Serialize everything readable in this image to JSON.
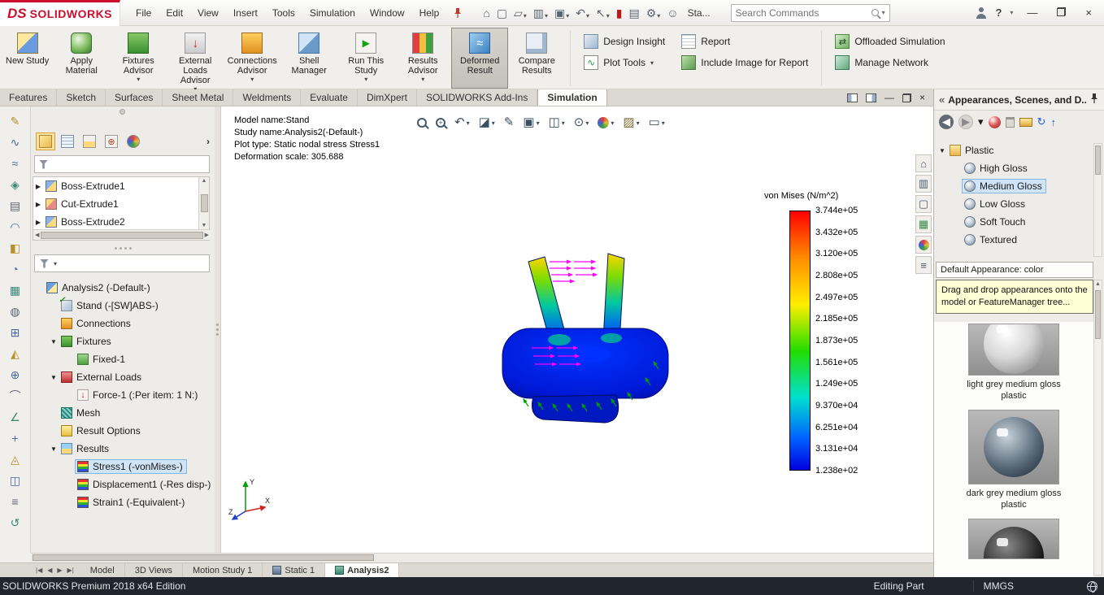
{
  "icons": {
    "chevron_right": "›",
    "caret_down": "▾",
    "caret_up": "▲",
    "caret_down_solid": "▼",
    "scroll_left": "◀",
    "scroll_right": "▶",
    "minimize": "—",
    "close": "×",
    "help": "?"
  },
  "titlebar": {
    "logo_ds": "DS",
    "logo_text": "SOLIDWORKS",
    "menus": [
      "File",
      "Edit",
      "View",
      "Insert",
      "Tools",
      "Simulation",
      "Window",
      "Help"
    ],
    "quick_tools": [
      {
        "icon": "home-icon",
        "glyph": "⌂"
      },
      {
        "icon": "new-document-icon",
        "glyph": "▢"
      },
      {
        "icon": "open-document-icon",
        "glyph": "▱",
        "caret": "▾"
      },
      {
        "icon": "save-icon",
        "glyph": "▥",
        "caret": "▾"
      },
      {
        "icon": "print-icon",
        "glyph": "▣",
        "caret": "▾"
      },
      {
        "icon": "undo-icon",
        "glyph": "↶",
        "caret": "▾"
      },
      {
        "icon": "select-icon",
        "glyph": "↖",
        "caret": "▾"
      },
      {
        "icon": "rebuild-icon",
        "glyph": "▮",
        "color": "#c01818"
      },
      {
        "icon": "file-properties-icon",
        "glyph": "▤"
      },
      {
        "icon": "options-icon",
        "glyph": "⚙",
        "caret": "▾"
      },
      {
        "icon": "add-user-icon",
        "glyph": "☺"
      },
      {
        "icon": "",
        "glyph": "",
        "label": "Sta..."
      }
    ],
    "search_placeholder": "Search Commands"
  },
  "ribbon": {
    "big_buttons": [
      {
        "label": "New Study",
        "icon": "new-study-icon"
      },
      {
        "label": "Apply Material",
        "icon": "apply-material-icon"
      },
      {
        "label": "Fixtures Advisor",
        "icon": "fixtures-advisor-icon",
        "caret": "▾"
      },
      {
        "label": "External Loads Advisor",
        "icon": "external-loads-advisor-icon",
        "caret": "▾"
      },
      {
        "label": "Connections Advisor",
        "icon": "connections-advisor-icon",
        "caret": "▾"
      },
      {
        "label": "Shell Manager",
        "icon": "shell-manager-icon"
      },
      {
        "label": "Run This Study",
        "icon": "run-this-study-icon",
        "caret": "▾"
      },
      {
        "label": "Results Advisor",
        "icon": "results-advisor-icon",
        "caret": "▾"
      },
      {
        "label": "Deformed Result",
        "icon": "deformed-result-icon",
        "active": true
      },
      {
        "label": "Compare Results",
        "icon": "compare-results-icon"
      }
    ],
    "group1": [
      {
        "label": "Design Insight",
        "icon": "design-insight-icon"
      },
      {
        "label": "Plot Tools",
        "icon": "plot-tools-icon",
        "caret": "▾"
      }
    ],
    "group2": [
      {
        "label": "Report",
        "icon": "report-icon"
      },
      {
        "label": "Include Image for Report",
        "icon": "include-image-icon"
      }
    ],
    "group3": [
      {
        "label": "Offloaded Simulation",
        "icon": "offloaded-simulation-icon"
      },
      {
        "label": "Manage Network",
        "icon": "manage-network-icon"
      }
    ]
  },
  "cm_tabs": {
    "items": [
      {
        "label": "Features"
      },
      {
        "label": "Sketch"
      },
      {
        "label": "Surfaces"
      },
      {
        "label": "Sheet Metal"
      },
      {
        "label": "Weldments"
      },
      {
        "label": "Evaluate"
      },
      {
        "label": "DimXpert"
      },
      {
        "label": "SOLIDWORKS Add-Ins"
      },
      {
        "label": "Simulation",
        "active": true
      }
    ]
  },
  "pane_controls": [
    {
      "icon": "pane-dock-left-icon"
    },
    {
      "icon": "pane-dock-right-icon"
    },
    {
      "icon": "pane-minimize-icon",
      "glyph": "—"
    },
    {
      "icon": "pane-restore-icon"
    },
    {
      "icon": "pane-close-icon",
      "glyph": "×"
    }
  ],
  "left_toolbar": {
    "items": [
      {
        "icon": "sketch-tool-icon",
        "glyph": "✎",
        "color": "#b8902a"
      },
      {
        "icon": "spline-tool-icon",
        "glyph": "∿",
        "color": "#4a6b9a"
      },
      {
        "icon": "style-spline-tool-icon",
        "glyph": "≈",
        "color": "#4a6b9a"
      },
      {
        "icon": "polygon-tool-icon",
        "glyph": "◈",
        "color": "#3a8a7a"
      },
      {
        "icon": "plane-tool-icon",
        "glyph": "▤",
        "color": "#5a6470"
      },
      {
        "icon": "arc-tool-icon",
        "glyph": "◠",
        "color": "#4a6b9a"
      },
      {
        "icon": "extrude-tool-icon",
        "glyph": "◧",
        "color": "#b8902a"
      },
      {
        "icon": "revolve-tool-icon",
        "glyph": "◔",
        "color": "#4a6b9a"
      },
      {
        "icon": "mesh-tool-icon",
        "glyph": "▦",
        "color": "#3a8a7a"
      },
      {
        "icon": "fillet-tool-icon",
        "glyph": "◍",
        "color": "#5a6470"
      },
      {
        "icon": "pattern-tool-icon",
        "glyph": "⊞",
        "color": "#4a6b9a"
      },
      {
        "icon": "draft-tool-icon",
        "glyph": "◭",
        "color": "#b8902a"
      },
      {
        "icon": "hole-tool-icon",
        "glyph": "⊕",
        "color": "#4a6b9a"
      },
      {
        "icon": "curve-tool-icon",
        "glyph": "⌒",
        "color": "#5a6470"
      },
      {
        "icon": "angle-tool-icon",
        "glyph": "∠",
        "color": "#3a8a7a"
      },
      {
        "icon": "add-geometry-icon",
        "glyph": "+",
        "color": "#4a6b9a"
      },
      {
        "icon": "loft-tool-icon",
        "glyph": "◬",
        "color": "#b8902a"
      },
      {
        "icon": "shell-tool-icon",
        "glyph": "◫",
        "color": "#4a6b9a"
      },
      {
        "icon": "list-tool-icon",
        "glyph": "≡",
        "color": "#5a6470"
      },
      {
        "icon": "rotate-tool-icon",
        "glyph": "↺",
        "color": "#3a8a7a"
      }
    ]
  },
  "fm_panel": {
    "tabs": [
      {
        "icon": "featuremanager-tab-icon",
        "active": true
      },
      {
        "icon": "propertymanager-tab-icon"
      },
      {
        "icon": "configurationmanager-tab-icon"
      },
      {
        "icon": "dimxpertmanager-tab-icon"
      },
      {
        "icon": "displaymanager-tab-icon"
      }
    ],
    "filter_placeholder": "",
    "tree1": [
      {
        "label": "Boss-Extrude1",
        "icon": "boss-extrude-icon",
        "caret": "▶"
      },
      {
        "label": "Cut-Extrude1",
        "icon": "cut-extrude-icon",
        "caret": "▶"
      },
      {
        "label": "Boss-Extrude2",
        "icon": "boss-extrude-icon",
        "caret": "▶"
      }
    ],
    "tree2": [
      {
        "label": "Analysis2 (-Default-)",
        "icon": "study-icon",
        "level": 0
      },
      {
        "label": "Stand (-[SW]ABS-)",
        "icon": "part-icon",
        "level": 1
      },
      {
        "label": "Connections",
        "icon": "connections-icon",
        "level": 1
      },
      {
        "label": "Fixtures",
        "icon": "fixtures-icon",
        "level": 1,
        "caret": "▼"
      },
      {
        "label": "Fixed-1",
        "icon": "fixed-icon",
        "level": 2
      },
      {
        "label": "External Loads",
        "icon": "external-loads-icon",
        "level": 1,
        "caret": "▼"
      },
      {
        "label": "Force-1 (:Per item: 1 N:)",
        "icon": "force-icon",
        "level": 2
      },
      {
        "label": "Mesh",
        "icon": "mesh-icon",
        "level": 1
      },
      {
        "label": "Result Options",
        "icon": "result-options-icon",
        "level": 1
      },
      {
        "label": "Results",
        "icon": "results-folder-icon",
        "level": 1,
        "caret": "▼"
      },
      {
        "label": "Stress1 (-vonMises-)",
        "icon": "stress-plot-icon",
        "level": 2,
        "selected": true
      },
      {
        "label": "Displacement1 (-Res disp-)",
        "icon": "displacement-plot-icon",
        "level": 2
      },
      {
        "label": "Strain1 (-Equivalent-)",
        "icon": "strain-plot-icon",
        "level": 2
      }
    ]
  },
  "viewport": {
    "info_lines": [
      "Model name:Stand",
      "Study name:Analysis2(-Default-)",
      "Plot type: Static nodal stress Stress1",
      "Deformation scale: 305.688"
    ],
    "hud": [
      {
        "icon": "zoom-fit-icon"
      },
      {
        "icon": "zoom-area-icon"
      },
      {
        "icon": "previous-view-icon",
        "glyph": "↶",
        "caret": "▾"
      },
      {
        "icon": "section-view-icon",
        "glyph": "◪",
        "caret": "▾"
      },
      {
        "icon": "annotations-icon",
        "glyph": "✎"
      },
      {
        "icon": "view-orientation-icon",
        "glyph": "▣",
        "caret": "▾"
      },
      {
        "icon": "display-style-icon",
        "glyph": "◫",
        "caret": "▾"
      },
      {
        "icon": "hide-show-items-icon",
        "glyph": "⊙",
        "caret": "▾"
      },
      {
        "icon": "edit-appearance-icon",
        "caret": "▾"
      },
      {
        "icon": "apply-scene-icon",
        "glyph": "▨",
        "caret": "▾"
      },
      {
        "icon": "view-settings-icon",
        "glyph": "▭",
        "caret": "▾"
      }
    ],
    "legend": {
      "title": "von Mises (N/m^2)",
      "ticks": [
        "3.744e+05",
        "3.432e+05",
        "3.120e+05",
        "2.808e+05",
        "2.497e+05",
        "2.185e+05",
        "1.873e+05",
        "1.561e+05",
        "1.249e+05",
        "9.370e+04",
        "6.251e+04",
        "3.131e+04",
        "1.238e+02"
      ]
    },
    "triad": {
      "x": "X",
      "y": "Y",
      "z": "Z"
    },
    "right_tools": [
      {
        "icon": "home-view-icon",
        "glyph": "⌂"
      },
      {
        "icon": "roll-view-icon",
        "glyph": "▥"
      },
      {
        "icon": "page-display-icon",
        "glyph": "▢"
      },
      {
        "icon": "snapshot-icon",
        "glyph": "▦",
        "color": "#3a8a4a"
      },
      {
        "icon": "display-pane-wheel-icon"
      },
      {
        "icon": "display-pane-list-icon",
        "glyph": "≡"
      }
    ]
  },
  "taskpane": {
    "collapse_glyph": "«",
    "title": "Appearances, Scenes, and D...",
    "toolbar": [
      {
        "icon": "back-icon",
        "glyph": "◀"
      },
      {
        "icon": "forward-icon",
        "glyph": "▶"
      },
      {
        "icon": "history-dropdown-icon",
        "glyph": "▾"
      },
      {
        "icon": "appearance-target-icon"
      },
      {
        "icon": "delete-icon"
      },
      {
        "icon": "open-folder-icon"
      },
      {
        "icon": "refresh-icon",
        "glyph": "↻"
      },
      {
        "icon": "up-icon",
        "glyph": "↑"
      }
    ],
    "tree": [
      {
        "label": "Plastic",
        "icon": "plastic-folder-icon",
        "level": 0,
        "caret": "▼"
      },
      {
        "label": "High Gloss",
        "icon": "appearance-ball-icon",
        "level": 1
      },
      {
        "label": "Medium Gloss",
        "icon": "appearance-ball-icon",
        "level": 1,
        "selected": true
      },
      {
        "label": "Low Gloss",
        "icon": "appearance-ball-icon",
        "level": 1
      },
      {
        "label": "Soft Touch",
        "icon": "appearance-ball-icon",
        "level": 1
      },
      {
        "label": "Textured",
        "icon": "appearance-ball-icon",
        "level": 1
      }
    ],
    "subtitle": "Default Appearance: color",
    "tooltip": "Drag and drop appearances onto the model or FeatureManager tree...",
    "thumbnails": [
      {
        "icon": "light-sphere-thumb",
        "caption": "light grey medium gloss plastic"
      },
      {
        "icon": "dark-sphere-thumb",
        "caption": "dark grey medium gloss plastic"
      },
      {
        "icon": "black-sphere-thumb",
        "caption": ""
      }
    ]
  },
  "bottom": {
    "nav": [
      "|◀",
      "◀",
      "▶",
      "▶|"
    ],
    "tabs": [
      {
        "label": "Model"
      },
      {
        "label": "3D Views"
      },
      {
        "label": "Motion Study 1"
      },
      {
        "label": "Static 1",
        "icon": "static-study-icon"
      },
      {
        "label": "Analysis2",
        "icon": "analysis-study-icon",
        "active": true
      }
    ]
  },
  "statusbar": {
    "left": "SOLIDWORKS Premium 2018 x64 Edition",
    "editing": "Editing Part",
    "units": "MMGS"
  }
}
